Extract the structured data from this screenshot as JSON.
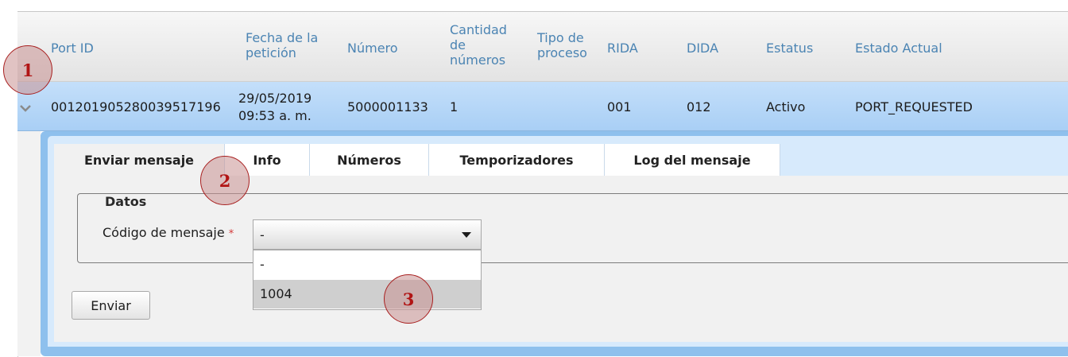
{
  "table": {
    "headers": {
      "port_id": "Port ID",
      "fecha": "Fecha de la petición",
      "numero": "Número",
      "cantidad": "Cantidad de números",
      "tipo": "Tipo de proceso",
      "rida": "RIDA",
      "dida": "DIDA",
      "estatus": "Estatus",
      "estado": "Estado Actual"
    },
    "row": {
      "port_id": "00120190528003951719​6",
      "fecha_line1": "29/05/2019",
      "fecha_line2": "09:53 a. m.",
      "numero": "5000001133",
      "cantidad": "1",
      "tipo": "",
      "rida": "001",
      "dida": "012",
      "estatus": "Activo",
      "estado": "PORT_REQUESTED"
    }
  },
  "tabs": [
    {
      "label": "Enviar mensaje",
      "active": true
    },
    {
      "label": "Info",
      "active": false
    },
    {
      "label": "Números",
      "active": false
    },
    {
      "label": "Temporizadores",
      "active": false
    },
    {
      "label": "Log del mensaje",
      "active": false
    }
  ],
  "form": {
    "legend": "Datos",
    "code_label": "Código de mensaje",
    "required_mark": "*",
    "selected_value": "-",
    "options": [
      "-",
      "1004"
    ],
    "highlighted_option": "1004",
    "submit_label": "Enviar"
  },
  "annotations": {
    "badge_1": "1",
    "badge_2": "2",
    "badge_3": "3"
  },
  "icons": {
    "expand_caret": "chevron-down-icon",
    "select_arrow": "triangle-down-icon"
  },
  "colors": {
    "header_text": "#4b84b3",
    "row_selected": "#a9cff5",
    "detail_border": "#8ec0ed",
    "badge_fill": "#c89191",
    "badge_border": "#a81f1f"
  }
}
